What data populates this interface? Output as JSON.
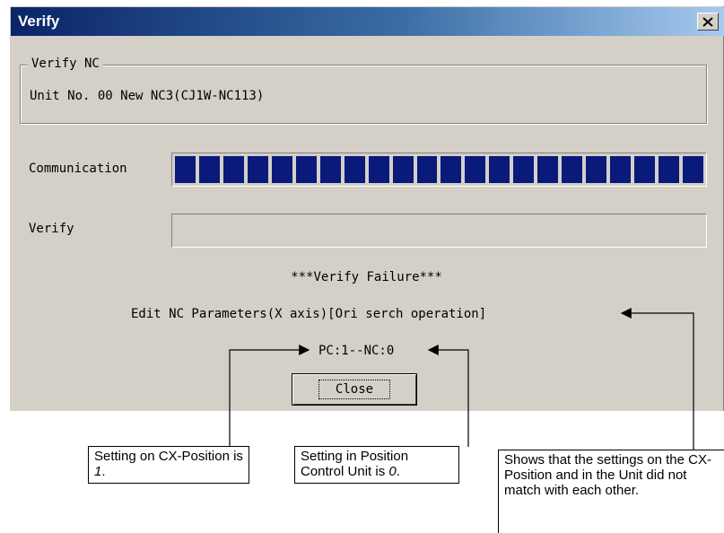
{
  "window": {
    "title": "Verify"
  },
  "group": {
    "legend": "Verify NC",
    "unit_text": "Unit No. 00 New NC3(CJ1W-NC113)"
  },
  "communication": {
    "label": "Communication",
    "progress_percent": 100,
    "segments": 22
  },
  "verify": {
    "label": "Verify",
    "progress_percent": 0
  },
  "messages": {
    "failure": "***Verify Failure***",
    "detail": "Edit NC Parameters(X axis)[Ori serch operation]",
    "values": "PC:1--NC:0"
  },
  "buttons": {
    "close_label": "Close"
  },
  "annotations": {
    "pc_setting": {
      "text": "Setting on CX-Position is ",
      "value": "1",
      "suffix": "."
    },
    "nc_setting": {
      "text": "Setting in Position Control Unit is ",
      "value": "0",
      "suffix": "."
    },
    "mismatch": {
      "text": "Shows that the settings on the CX-Position and in the Unit did not match with each other."
    }
  }
}
